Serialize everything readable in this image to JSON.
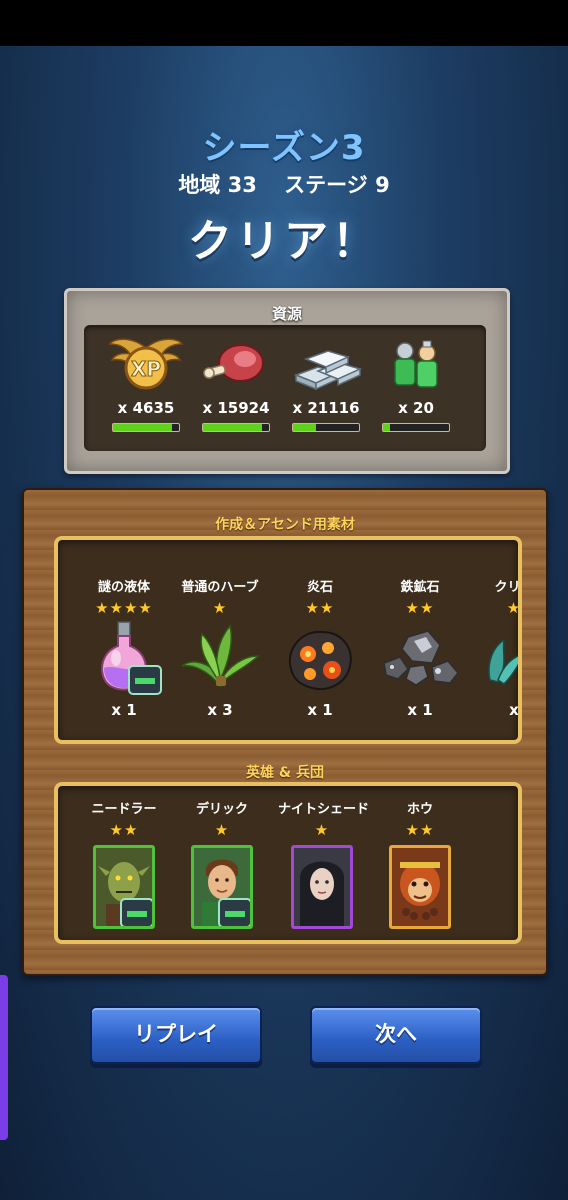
{
  "header": {
    "season": "シーズン3",
    "region": "地域 33",
    "stage": "ステージ 9",
    "result": "クリア！"
  },
  "resources": {
    "title": "資源",
    "items": [
      {
        "icon": "xp-wings-icon",
        "count": "x 4635",
        "progress": 0.9
      },
      {
        "icon": "meat-icon",
        "count": "x 15924",
        "progress": 0.9
      },
      {
        "icon": "iron-ingot-icon",
        "count": "x 21116",
        "progress": 0.35
      },
      {
        "icon": "troops-icon",
        "count": "x 20",
        "progress": 0.1
      }
    ]
  },
  "materials": {
    "title": "作成＆アセンド用素材",
    "items": [
      {
        "name": "謎の液体",
        "stars": "★★★★",
        "icon": "potion-flask-icon",
        "count": "x 1",
        "badge": true
      },
      {
        "name": "普通のハーブ",
        "stars": "★",
        "icon": "herb-leaves-icon",
        "count": "x 3",
        "badge": false
      },
      {
        "name": "炎石",
        "stars": "★★",
        "icon": "fire-rock-icon",
        "count": "x 1",
        "badge": false
      },
      {
        "name": "鉄鉱石",
        "stars": "★★",
        "icon": "iron-ore-icon",
        "count": "x 1",
        "badge": false
      },
      {
        "name": "クリプ",
        "stars": "★",
        "icon": "crystal-icon",
        "count": "x",
        "badge": false
      }
    ]
  },
  "heroes": {
    "title": "英雄 & 兵団",
    "items": [
      {
        "name": "ニードラー",
        "stars": "★★",
        "icon": "goblin-portrait-icon",
        "frame_color": "#4fc23a",
        "badge": true
      },
      {
        "name": "デリック",
        "stars": "★",
        "icon": "archer-portrait-icon",
        "frame_color": "#4fc23a",
        "badge": true
      },
      {
        "name": "ナイトシェード",
        "stars": "★",
        "icon": "assassin-portrait-icon",
        "frame_color": "#a249d6",
        "badge": false
      },
      {
        "name": "ホウ",
        "stars": "★★",
        "icon": "monkey-king-portrait-icon",
        "frame_color": "#e8a83a",
        "badge": false
      }
    ]
  },
  "buttons": {
    "replay": "リプレイ",
    "next": "次へ"
  },
  "colors": {
    "season_text": "#7fc4ff",
    "star": "#ffc928",
    "section_title": "#ffd35a",
    "button_blue": "#2c5fc4"
  }
}
